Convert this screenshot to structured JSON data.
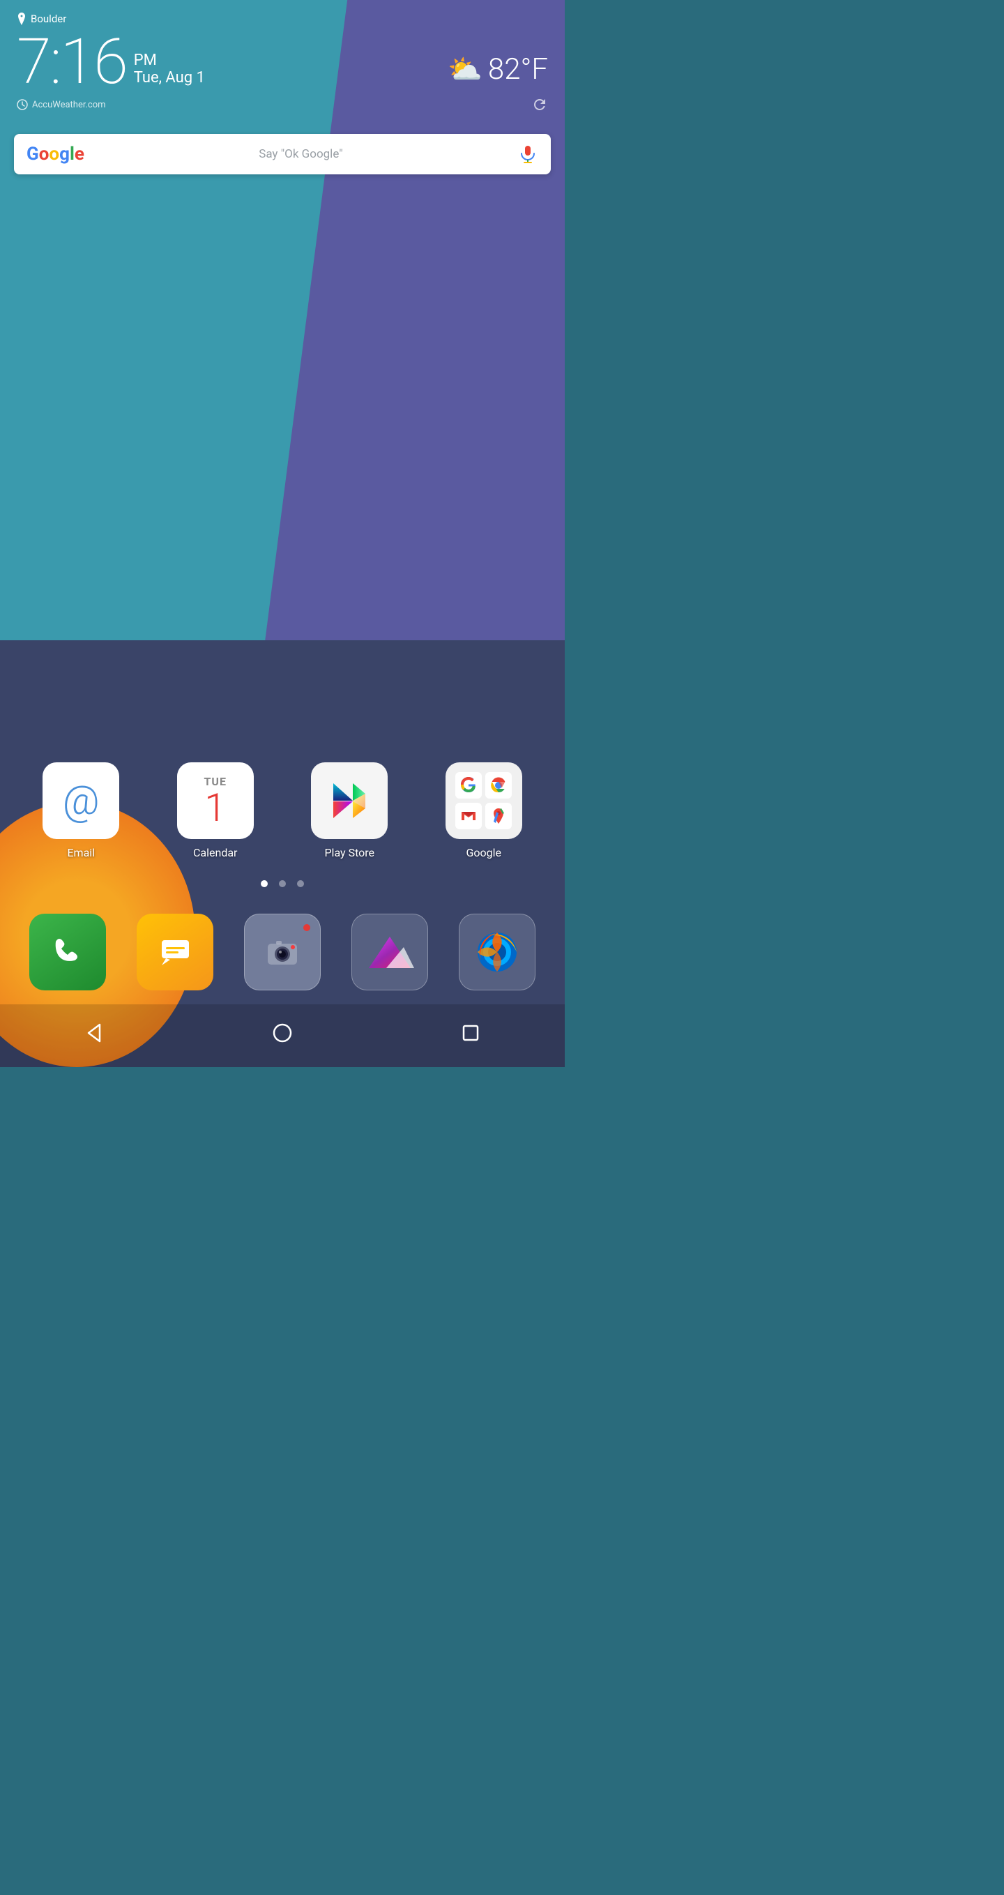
{
  "location": "Boulder",
  "time": {
    "hour_min": "7:16",
    "ampm": "PM",
    "date": "Tue, Aug 1"
  },
  "weather": {
    "temp": "82°F",
    "icon": "partly-cloudy"
  },
  "accuweather": "AccuWeather.com",
  "search": {
    "placeholder": "Say \"Ok Google\""
  },
  "apps": [
    {
      "label": "Email",
      "icon": "email"
    },
    {
      "label": "Calendar",
      "icon": "calendar",
      "day": "TUE",
      "date": "1"
    },
    {
      "label": "Play Store",
      "icon": "play-store"
    },
    {
      "label": "Google",
      "icon": "google-folder"
    }
  ],
  "dock": [
    {
      "label": "Phone",
      "icon": "phone"
    },
    {
      "label": "Messages",
      "icon": "messages"
    },
    {
      "label": "Camera",
      "icon": "camera"
    },
    {
      "label": "Gallery",
      "icon": "gallery"
    },
    {
      "label": "Firefox",
      "icon": "firefox"
    }
  ],
  "page_dots": [
    "active",
    "inactive",
    "inactive"
  ],
  "nav": {
    "back": "◁",
    "home": "○",
    "recents": "□"
  }
}
